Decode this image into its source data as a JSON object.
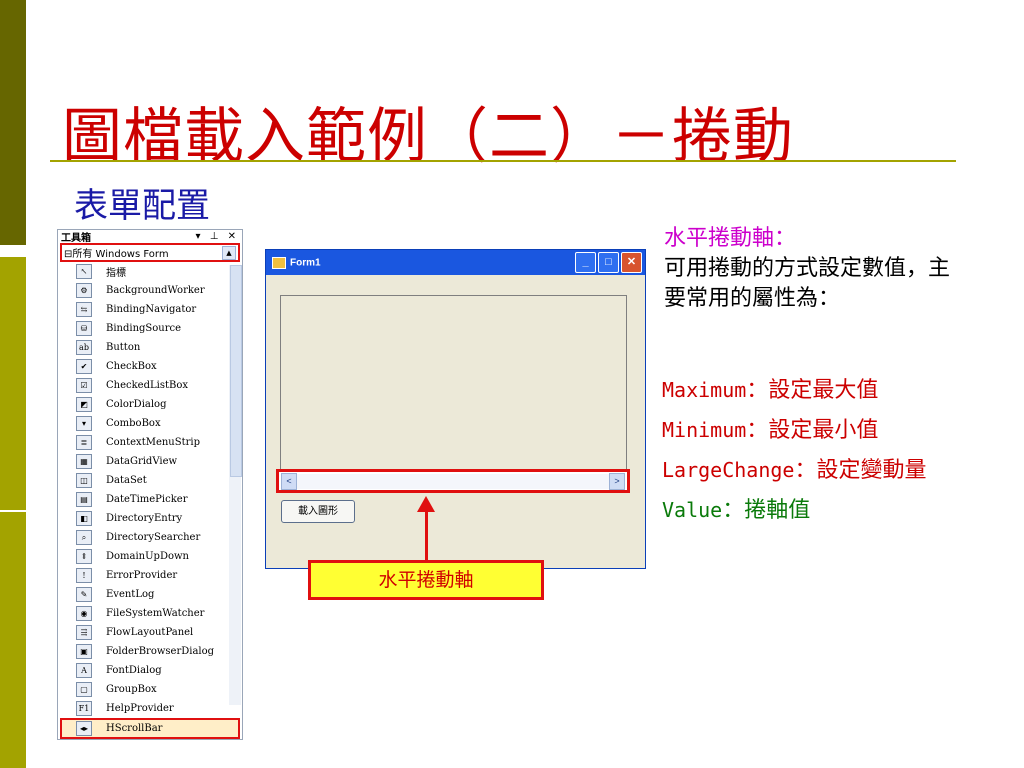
{
  "slide": {
    "title": "圖檔載入範例（二）－捲動",
    "subtitle": "表單配置",
    "colors": {
      "title": "#cc0000",
      "subtitle": "#1a1aa6",
      "accent_bar": "#a3a300",
      "highlight": "#e01010",
      "callout_bg": "#ffff33"
    }
  },
  "toolbox": {
    "title": "工具箱",
    "controls": "▾ ⊥ ✕",
    "group_label": "⊟所有 Windows Form",
    "items": [
      {
        "label": "指標",
        "icon": "pointer-icon",
        "glyph": "↖"
      },
      {
        "label": "BackgroundWorker",
        "icon": "backgroundworker-icon",
        "glyph": "⚙"
      },
      {
        "label": "BindingNavigator",
        "icon": "bindingnavigator-icon",
        "glyph": "⇆"
      },
      {
        "label": "BindingSource",
        "icon": "bindingsource-icon",
        "glyph": "⛁"
      },
      {
        "label": "Button",
        "icon": "button-icon",
        "glyph": "ab"
      },
      {
        "label": "CheckBox",
        "icon": "checkbox-icon",
        "glyph": "✔"
      },
      {
        "label": "CheckedListBox",
        "icon": "checkedlistbox-icon",
        "glyph": "☑"
      },
      {
        "label": "ColorDialog",
        "icon": "colordialog-icon",
        "glyph": "◩"
      },
      {
        "label": "ComboBox",
        "icon": "combobox-icon",
        "glyph": "▾"
      },
      {
        "label": "ContextMenuStrip",
        "icon": "contextmenustrip-icon",
        "glyph": "≣"
      },
      {
        "label": "DataGridView",
        "icon": "datagridview-icon",
        "glyph": "▦"
      },
      {
        "label": "DataSet",
        "icon": "dataset-icon",
        "glyph": "◫"
      },
      {
        "label": "DateTimePicker",
        "icon": "datetimepicker-icon",
        "glyph": "▤"
      },
      {
        "label": "DirectoryEntry",
        "icon": "directoryentry-icon",
        "glyph": "◧"
      },
      {
        "label": "DirectorySearcher",
        "icon": "directorysearcher-icon",
        "glyph": "⌕"
      },
      {
        "label": "DomainUpDown",
        "icon": "domainupdown-icon",
        "glyph": "⇕"
      },
      {
        "label": "ErrorProvider",
        "icon": "errorprovider-icon",
        "glyph": "!"
      },
      {
        "label": "EventLog",
        "icon": "eventlog-icon",
        "glyph": "✎"
      },
      {
        "label": "FileSystemWatcher",
        "icon": "filesystemwatcher-icon",
        "glyph": "◉"
      },
      {
        "label": "FlowLayoutPanel",
        "icon": "flowlayoutpanel-icon",
        "glyph": "⇶"
      },
      {
        "label": "FolderBrowserDialog",
        "icon": "folderbrowserdialog-icon",
        "glyph": "▣"
      },
      {
        "label": "FontDialog",
        "icon": "fontdialog-icon",
        "glyph": "A"
      },
      {
        "label": "GroupBox",
        "icon": "groupbox-icon",
        "glyph": "▢"
      },
      {
        "label": "HelpProvider",
        "icon": "helpprovider-icon",
        "glyph": "F1"
      }
    ],
    "selected_item": {
      "label": "HScrollBar",
      "icon": "hscrollbar-icon",
      "glyph": "◂▸"
    }
  },
  "form": {
    "title": "Form1",
    "load_button": "載入圖形",
    "scroll_left": "<",
    "scroll_right": ">"
  },
  "callout": "水平捲動軸",
  "description": {
    "heading": "水平捲動軸：",
    "body": "可用捲動的方式設定數值，主要常用的屬性為："
  },
  "properties": [
    {
      "name": "Maximum",
      "sep": "：",
      "desc": "設定最大值",
      "color": "#cc0000"
    },
    {
      "name": "Minimum",
      "sep": "：",
      "desc": "設定最小值",
      "color": "#cc0000"
    },
    {
      "name": "LargeChange",
      "sep": "：",
      "desc": "設定變動量",
      "color": "#cc0000"
    },
    {
      "name": "Value",
      "sep": "：",
      "desc": "捲軸值",
      "color": "#0a7a0a"
    }
  ]
}
